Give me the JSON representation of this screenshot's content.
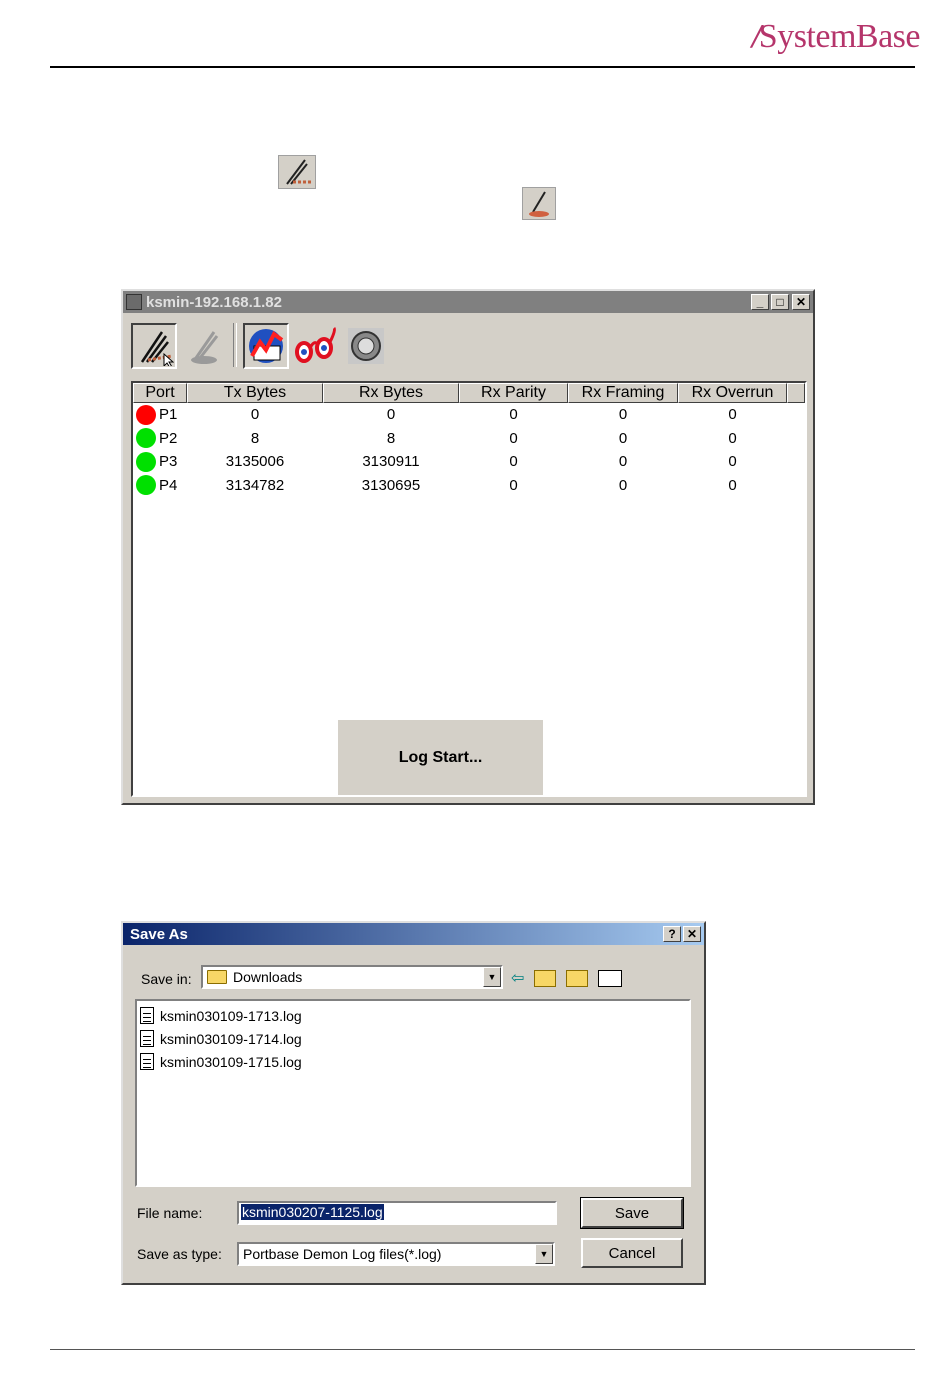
{
  "header": {
    "brand_prefix": "/",
    "brand_name": "SystemBase"
  },
  "monitor_window": {
    "title": "ksmin-192.168.1.82",
    "columns": [
      "Port",
      "Tx Bytes",
      "Rx Bytes",
      "Rx Parity",
      "Rx Framing",
      "Rx Overrun"
    ],
    "rows": [
      {
        "status": "red",
        "port": "P1",
        "tx": "0",
        "rx": "0",
        "parity": "0",
        "framing": "0",
        "overrun": "0"
      },
      {
        "status": "green",
        "port": "P2",
        "tx": "8",
        "rx": "8",
        "parity": "0",
        "framing": "0",
        "overrun": "0"
      },
      {
        "status": "green",
        "port": "P3",
        "tx": "3135006",
        "rx": "3130911",
        "parity": "0",
        "framing": "0",
        "overrun": "0"
      },
      {
        "status": "green",
        "port": "P4",
        "tx": "3134782",
        "rx": "3130695",
        "parity": "0",
        "framing": "0",
        "overrun": "0"
      }
    ],
    "popup": "Log Start...",
    "toolbar": [
      "log-start-icon",
      "log-stop-icon",
      "chart-icon",
      "glasses-icon",
      "settings-icon"
    ]
  },
  "save_dialog": {
    "title": "Save As",
    "save_in_label": "Save in:",
    "save_in_value": "Downloads",
    "files": [
      "ksmin030109-1713.log",
      "ksmin030109-1714.log",
      "ksmin030109-1715.log"
    ],
    "file_name_label": "File name:",
    "file_name_value": "ksmin030207-1125.log",
    "save_type_label": "Save as type:",
    "save_type_value": "Portbase Demon Log files(*.log)",
    "save_button": "Save",
    "cancel_button": "Cancel"
  }
}
